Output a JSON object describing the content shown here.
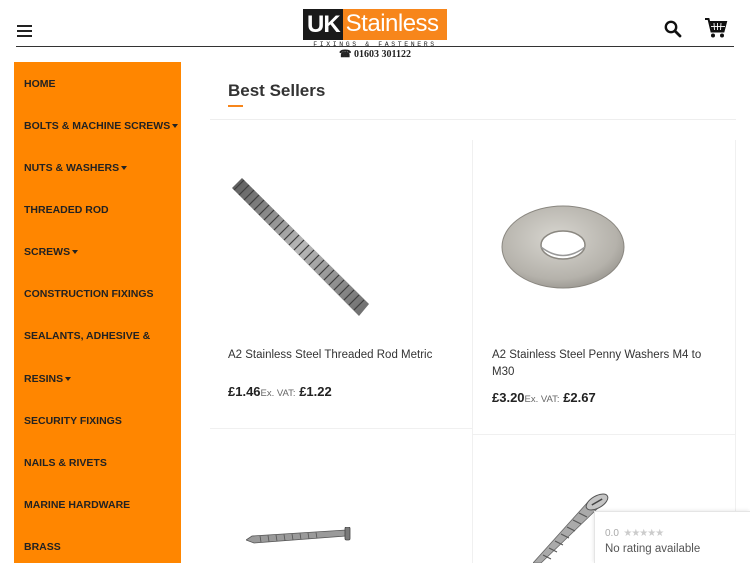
{
  "header": {
    "logo_uk": "UK",
    "logo_stainless": "Stainless",
    "logo_sub": "FIXINGS & FASTENERS",
    "phone": "☎ 01603 301122"
  },
  "sidebar": {
    "items": [
      {
        "label": "HOME",
        "dropdown": false
      },
      {
        "label": "BOLTS & MACHINE SCREWS",
        "dropdown": true
      },
      {
        "label": "NUTS & WASHERS",
        "dropdown": true
      },
      {
        "label": "THREADED ROD",
        "dropdown": false
      },
      {
        "label": "SCREWS",
        "dropdown": true
      },
      {
        "label": "CONSTRUCTION FIXINGS",
        "dropdown": false
      },
      {
        "label": "SEALANTS, ADHESIVE &",
        "dropdown": false
      },
      {
        "label": "RESINS",
        "dropdown": true
      },
      {
        "label": "SECURITY FIXINGS",
        "dropdown": false
      },
      {
        "label": "NAILS & RIVETS",
        "dropdown": false
      },
      {
        "label": "MARINE HARDWARE",
        "dropdown": false
      },
      {
        "label": "BRASS",
        "dropdown": false
      }
    ]
  },
  "main": {
    "section_title": "Best Sellers",
    "products": [
      {
        "name": "A2 Stainless Steel Threaded Rod Metric",
        "price": "£1.46",
        "vat_label": "Ex. VAT:",
        "ex_vat_price": "£1.22",
        "image": "threaded-rod-image"
      },
      {
        "name": "A2 Stainless Steel Penny Washers M4 to M30",
        "price": "£3.20",
        "vat_label": "Ex. VAT:",
        "ex_vat_price": "£2.67",
        "image": "penny-washer-image"
      },
      {
        "name": "",
        "image": "nail-image"
      },
      {
        "name": "",
        "image": "screw-image"
      }
    ]
  },
  "rating_widget": {
    "score": "0.0",
    "stars": "★★★★★",
    "text": "No rating available"
  },
  "colors": {
    "accent": "#ff8600",
    "logo_orange": "#f7861b",
    "logo_dark": "#1a1a1a"
  }
}
